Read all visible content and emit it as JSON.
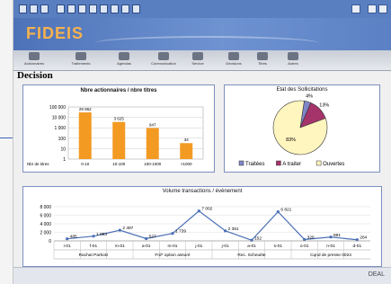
{
  "app": {
    "logo_main": "FIDEIS",
    "brand": "DEAL"
  },
  "nav": [
    "Actionnaires",
    "Traitements",
    "Agendas",
    "Communication",
    "Service",
    "Decisions",
    "Titres",
    "Autres"
  ],
  "page_title": "Decision",
  "chart_data": [
    {
      "type": "bar",
      "title": "Nbre actionnaires / nbre titres",
      "y_ticks": [
        "100 000",
        "10 000",
        "1 000",
        "100",
        "10",
        "1"
      ],
      "row_label": "Nbr de titres",
      "categories": [
        "0-10",
        "10-100",
        "100-1000",
        ">1000"
      ],
      "values": [
        29962,
        3625,
        947,
        34
      ],
      "labels": [
        "29 962",
        "3 625",
        "947",
        "34"
      ],
      "scale": "log",
      "color": "#f39a23"
    },
    {
      "type": "pie",
      "title": "Etat des Sollicitations",
      "slices": [
        {
          "name": "Traitées",
          "value": 4,
          "label": "4%",
          "color": "#7f86c8"
        },
        {
          "name": "A traiter",
          "value": 13,
          "label": "13%",
          "color": "#a5346b"
        },
        {
          "name": "Ouvertes",
          "value": 83,
          "label": "83%",
          "color": "#fff5bf"
        }
      ]
    },
    {
      "type": "line",
      "title": "Volume transactions / évènement",
      "y_ticks": [
        "8 000",
        "6 000",
        "4 000",
        "2 000",
        "0"
      ],
      "ylim": [
        0,
        8000
      ],
      "x": [
        "i-01",
        "f-01",
        "m-01",
        "a-01",
        "m-01",
        "j-01",
        "j-01",
        "a-01",
        "s-01",
        "o-01",
        "n-01",
        "d-01"
      ],
      "values": [
        485,
        1093,
        2497,
        527,
        1739,
        7002,
        2351,
        152,
        6821,
        326,
        891,
        264
      ],
      "labels": [
        "485",
        "1 093",
        "2 497",
        "527",
        "1 739",
        "7 002",
        "2 351",
        "152",
        "6 821",
        "326",
        "891",
        "264"
      ],
      "groups": [
        "Rachat Parkotz",
        "Frd* option assuré",
        "Rec. Scheuitte",
        "Cqnd de presse 0024"
      ],
      "color": "#4b6fb4"
    }
  ]
}
